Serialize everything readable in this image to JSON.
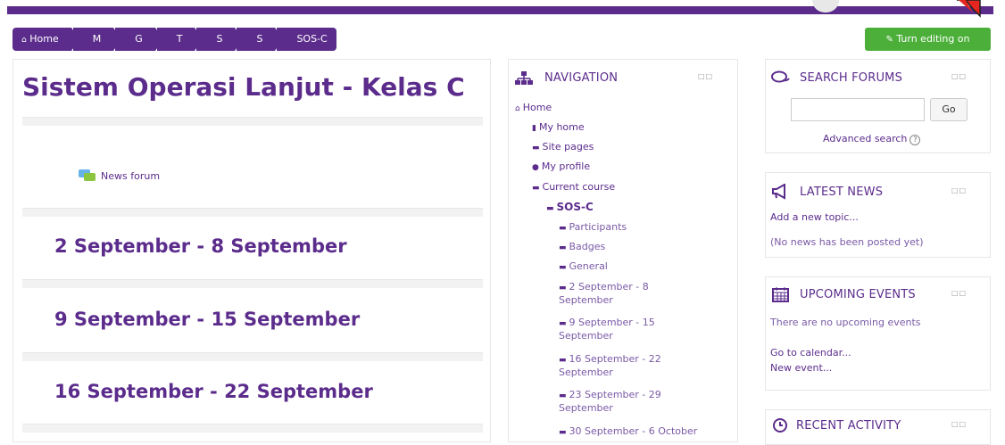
{
  "breadcrumb": {
    "items": [
      {
        "label": "Home",
        "icon": "home-icon"
      },
      {
        "label": "M"
      },
      {
        "label": "G"
      },
      {
        "label": "T"
      },
      {
        "label": "S"
      },
      {
        "label": "S"
      },
      {
        "label": "SOS-C"
      }
    ]
  },
  "toolbar": {
    "edit_label": "Turn editing on"
  },
  "course": {
    "title": "Sistem Operasi Lanjut - Kelas C",
    "news_forum": "News forum",
    "weeks": [
      "2 September - 8 September",
      "9 September - 15 September",
      "16 September - 22 September"
    ]
  },
  "navigation": {
    "title": "NAVIGATION",
    "items": [
      {
        "label": "Home",
        "icon": "home-icon",
        "level": 0
      },
      {
        "label": "My home",
        "icon": "page-icon",
        "level": 1
      },
      {
        "label": "Site pages",
        "icon": "folder-icon",
        "level": 1
      },
      {
        "label": "My profile",
        "icon": "user-icon",
        "level": 1
      },
      {
        "label": "Current course",
        "icon": "folder-icon",
        "level": 1
      },
      {
        "label": "SOS-C",
        "icon": "folder-icon",
        "level": 2
      },
      {
        "label": "Participants",
        "icon": "folder-icon",
        "level": 3
      },
      {
        "label": "Badges",
        "icon": "folder-icon",
        "level": 3
      },
      {
        "label": "General",
        "icon": "folder-icon",
        "level": 3
      },
      {
        "label": "2 September - 8",
        "label2": "September",
        "icon": "folder-icon",
        "level": 3
      },
      {
        "label": "9 September - 15",
        "label2": "September",
        "icon": "folder-icon",
        "level": 3
      },
      {
        "label": "16 September - 22",
        "label2": "September",
        "icon": "folder-icon",
        "level": 3
      },
      {
        "label": "23 September - 29",
        "label2": "September",
        "icon": "folder-icon",
        "level": 3
      },
      {
        "label": "30 September - 6 October",
        "icon": "folder-icon",
        "level": 3
      }
    ]
  },
  "search_forums": {
    "title": "SEARCH FORUMS",
    "go_label": "Go",
    "advanced": "Advanced search",
    "help": "?"
  },
  "latest_news": {
    "title": "LATEST NEWS",
    "add_topic": "Add a new topic...",
    "empty": "(No news has been posted yet)"
  },
  "upcoming_events": {
    "title": "UPCOMING EVENTS",
    "empty": "There are no upcoming events",
    "calendar": "Go to calendar...",
    "new_event": "New event..."
  },
  "recent_activity": {
    "title": "RECENT ACTIVITY"
  },
  "colors": {
    "accent": "#5b2c8c",
    "edit_button": "#4caf3a",
    "arrow": "#e4261e"
  }
}
